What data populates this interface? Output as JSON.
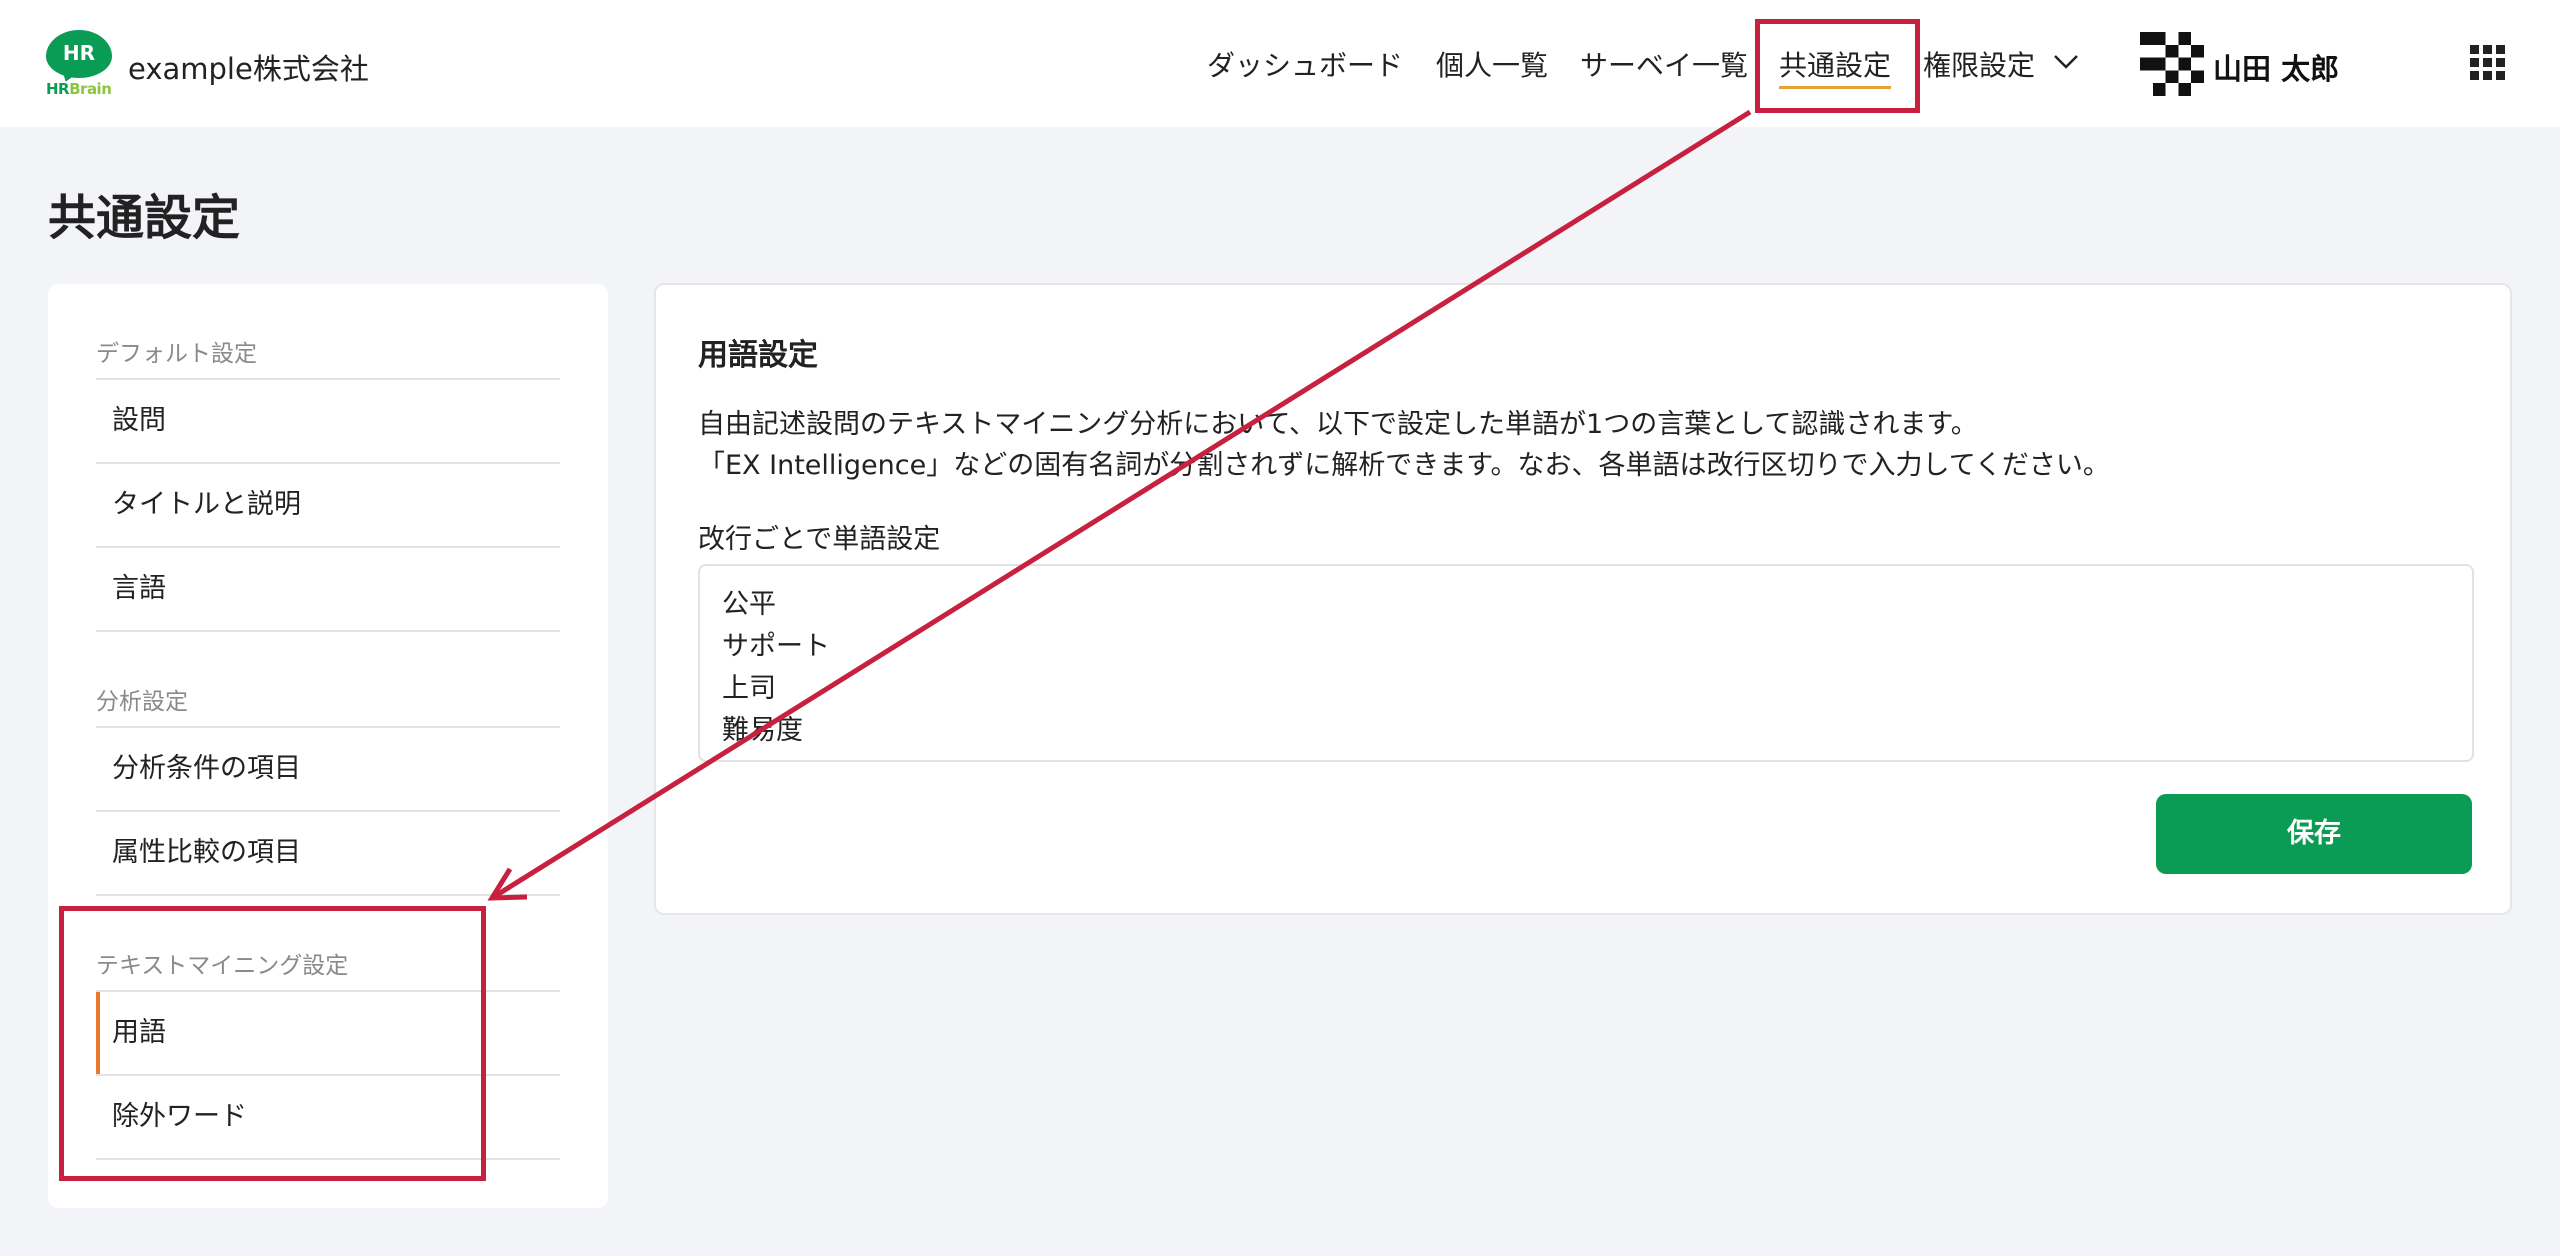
{
  "header": {
    "logo": {
      "bubble_text": "HR",
      "brand_hr": "HR",
      "brand_rest": "Brain"
    },
    "company": "example株式会社",
    "nav": [
      {
        "label": "ダッシュボード"
      },
      {
        "label": "個人一覧"
      },
      {
        "label": "サーベイ一覧"
      },
      {
        "label": "共通設定",
        "active": true
      },
      {
        "label": "権限設定",
        "has_dropdown": true
      }
    ],
    "user_name": "山田 太郎"
  },
  "page": {
    "title": "共通設定"
  },
  "sidebar": {
    "sections": [
      {
        "label": "デフォルト設定",
        "items": [
          "設問",
          "タイトルと説明",
          "言語"
        ]
      },
      {
        "label": "分析設定",
        "items": [
          "分析条件の項目",
          "属性比較の項目"
        ]
      },
      {
        "label": "テキストマイニング設定",
        "items": [
          "用語",
          "除外ワード"
        ]
      }
    ],
    "active_item": "用語"
  },
  "main": {
    "title": "用語設定",
    "description": [
      "自由記述設問のテキストマイニング分析において、以下で設定した単語が1つの言葉として認識されます。",
      "「EX Intelligence」などの固有名詞が分割されずに解析できます。なお、各単語は改行区切りで入力してください。"
    ],
    "field_label": "改行ごとで単語設定",
    "terms": [
      "公平",
      "サポート",
      "上司",
      "難易度"
    ],
    "save_label": "保存"
  },
  "colors": {
    "brand_green": "#0a9b55",
    "active_accent": "#e8782c",
    "nav_underline": "#e3a13a",
    "annotation_red": "#c8203f"
  },
  "icons": {
    "dropdown": "chevron-down-icon",
    "apps": "grid-icon",
    "avatar": "pixel-avatar-icon"
  }
}
